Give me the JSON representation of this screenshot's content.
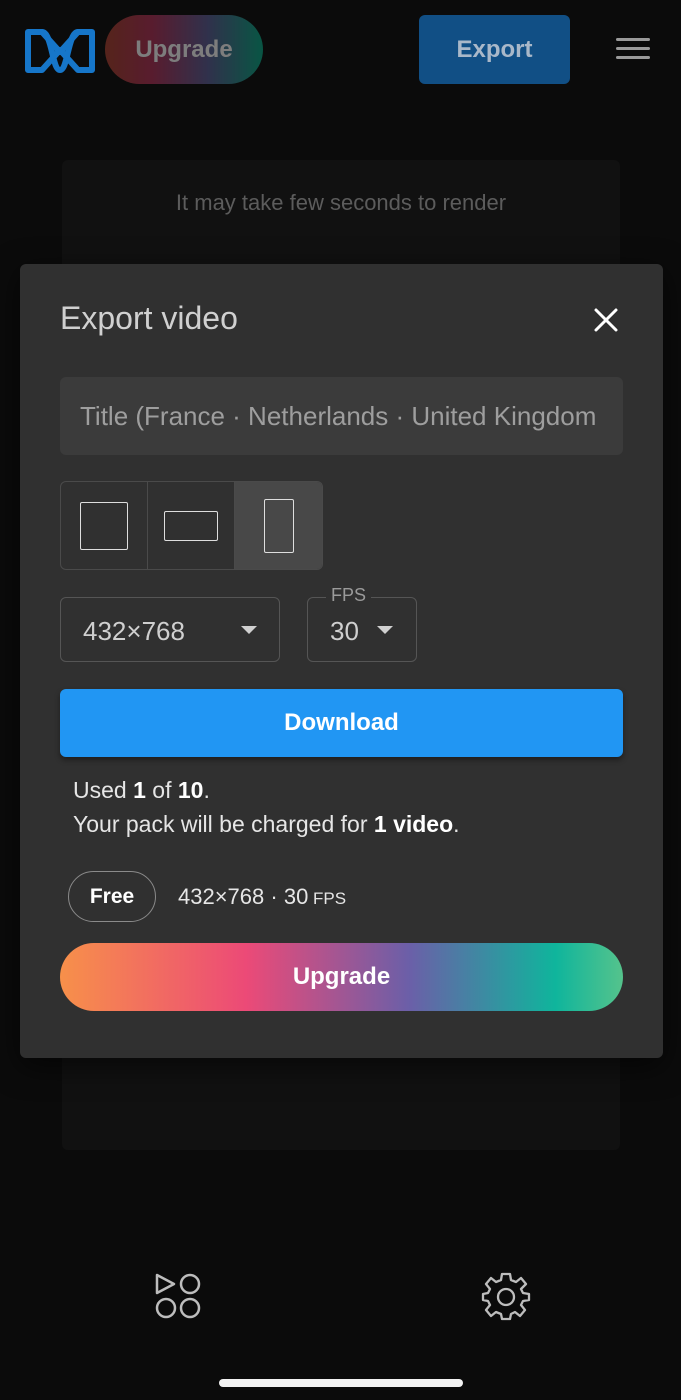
{
  "header": {
    "logo_icon": "infinity-logo-icon",
    "upgrade_label": "Upgrade",
    "export_label": "Export",
    "menu_icon": "hamburger-menu-icon"
  },
  "preview": {
    "render_message": "It may take few seconds to render"
  },
  "modal": {
    "title": "Export video",
    "close_icon": "close-icon",
    "title_field": {
      "value": "Title (France · Netherlands · United Kingdom"
    },
    "aspect_ratios": [
      {
        "name": "square",
        "selected": false
      },
      {
        "name": "landscape",
        "selected": false
      },
      {
        "name": "portrait",
        "selected": true
      }
    ],
    "resolution": {
      "selected": "432×768"
    },
    "fps": {
      "label": "FPS",
      "selected": "30"
    },
    "download_label": "Download",
    "usage": {
      "used_prefix": "Used ",
      "used": "1",
      "of_text": " of ",
      "total": "10",
      "period": ".",
      "charge_prefix": "Your pack will be charged for ",
      "charge_amount": "1 video",
      "charge_suffix": "."
    },
    "plan": {
      "badge": "Free",
      "resolution": "432×768",
      "separator": " · ",
      "fps_value": "30",
      "fps_unit": " FPS"
    },
    "upgrade_label": "Upgrade"
  },
  "bottom_nav": {
    "templates_icon": "shapes-templates-icon",
    "settings_icon": "gear-icon"
  },
  "colors": {
    "primary": "#2196f3",
    "background": "#0b0b0b",
    "modal": "#303030"
  }
}
